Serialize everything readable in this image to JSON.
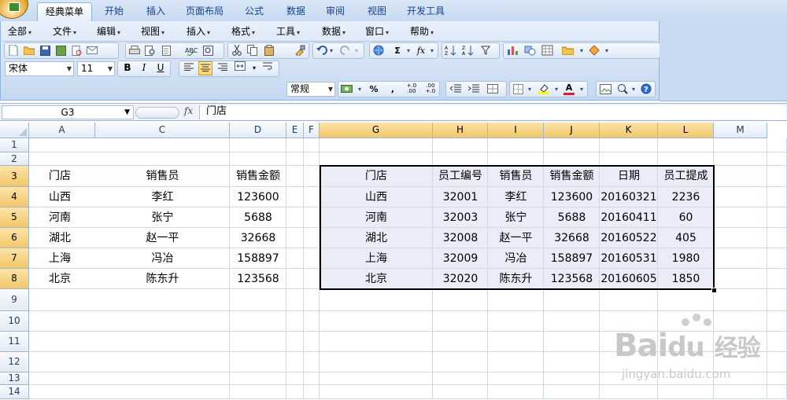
{
  "ribbon_tabs": [
    "经典菜单",
    "开始",
    "插入",
    "页面布局",
    "公式",
    "数据",
    "审阅",
    "视图",
    "开发工具"
  ],
  "active_tab": "经典菜单",
  "menus": [
    "全部",
    "文件",
    "编辑",
    "视图",
    "插入",
    "格式",
    "工具",
    "数据",
    "窗口",
    "帮助"
  ],
  "toolbar": {
    "font_name": "宋体",
    "font_size": "11",
    "bold": "B",
    "italic": "I",
    "underline": "U",
    "number_format": "常规",
    "percent": "%",
    "comma": ",",
    "inc_decimal": "+.0 .00",
    "dec_decimal": ".00 +.0",
    "sigma": "Σ",
    "fx": "fx",
    "font_color_letter": "A"
  },
  "formula_bar": {
    "name_box": "G3",
    "fx_label": "fx",
    "content": "门店"
  },
  "columns": [
    {
      "letter": "A",
      "selected": false
    },
    {
      "letter": "C",
      "selected": false
    },
    {
      "letter": "D",
      "selected": false
    },
    {
      "letter": "E",
      "selected": false
    },
    {
      "letter": "F",
      "selected": false
    },
    {
      "letter": "G",
      "selected": true
    },
    {
      "letter": "H",
      "selected": true
    },
    {
      "letter": "I",
      "selected": true
    },
    {
      "letter": "J",
      "selected": true
    },
    {
      "letter": "K",
      "selected": true
    },
    {
      "letter": "L",
      "selected": true
    },
    {
      "letter": "M",
      "selected": false
    }
  ],
  "rows": [
    {
      "num": "1",
      "selected": false
    },
    {
      "num": "2",
      "selected": false
    },
    {
      "num": "3",
      "selected": true
    },
    {
      "num": "4",
      "selected": true
    },
    {
      "num": "5",
      "selected": true
    },
    {
      "num": "6",
      "selected": true
    },
    {
      "num": "7",
      "selected": true
    },
    {
      "num": "8",
      "selected": true
    },
    {
      "num": "9",
      "selected": false
    },
    {
      "num": "10",
      "selected": false
    },
    {
      "num": "11",
      "selected": false
    },
    {
      "num": "12",
      "selected": false
    },
    {
      "num": "13",
      "selected": false
    },
    {
      "num": "14",
      "selected": false
    }
  ],
  "left_table": {
    "headers": [
      "门店",
      "销售员",
      "销售金额"
    ],
    "rows": [
      [
        "山西",
        "李红",
        "123600"
      ],
      [
        "河南",
        "张宁",
        "5688"
      ],
      [
        "湖北",
        "赵一平",
        "32668"
      ],
      [
        "上海",
        "冯冶",
        "158897"
      ],
      [
        "北京",
        "陈东升",
        "123568"
      ]
    ]
  },
  "right_table": {
    "headers": [
      "门店",
      "员工编号",
      "销售员",
      "销售金额",
      "日期",
      "员工提成"
    ],
    "rows": [
      [
        "山西",
        "32001",
        "李红",
        "123600",
        "20160321",
        "2236"
      ],
      [
        "河南",
        "32003",
        "张宁",
        "5688",
        "20160411",
        "60"
      ],
      [
        "湖北",
        "32008",
        "赵一平",
        "32668",
        "20160522",
        "405"
      ],
      [
        "上海",
        "32009",
        "冯冶",
        "158897",
        "20160531",
        "1980"
      ],
      [
        "北京",
        "32020",
        "陈东升",
        "123568",
        "20160605",
        "1850"
      ]
    ]
  },
  "watermark": {
    "brand": "Bai",
    "brand_cn": "经验",
    "url": "jingyan.baidu.com"
  }
}
